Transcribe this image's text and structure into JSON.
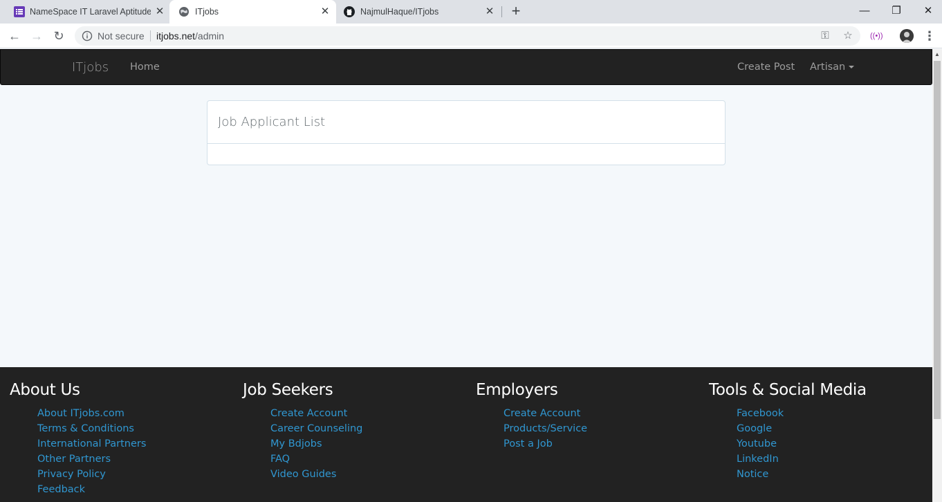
{
  "browser": {
    "tabs": [
      {
        "title": "NameSpace IT Laravel Aptitude T",
        "icon": "forms-icon",
        "active": false
      },
      {
        "title": "ITjobs",
        "icon": "globe-icon",
        "active": true
      },
      {
        "title": "NajmulHaque/ITjobs",
        "icon": "github-icon",
        "active": false
      }
    ],
    "address": {
      "security_label": "Not secure",
      "url_host": "itjobs.net",
      "url_path": "/admin"
    }
  },
  "site": {
    "brand": "ITjobs",
    "nav": {
      "home": "Home",
      "create_post": "Create Post",
      "user_menu": "Artisan"
    },
    "panel": {
      "title": "Job Applicant List"
    },
    "footer": {
      "columns": [
        {
          "heading": "About Us",
          "links": [
            "About ITjobs.com",
            "Terms & Conditions",
            "International Partners",
            "Other Partners",
            "Privacy Policy",
            "Feedback"
          ]
        },
        {
          "heading": "Job Seekers",
          "links": [
            "Create Account",
            "Career Counseling",
            "My Bdjobs",
            "FAQ",
            "Video Guides"
          ]
        },
        {
          "heading": "Employers",
          "links": [
            "Create Account",
            "Products/Service",
            "Post a Job"
          ]
        },
        {
          "heading": "Tools & Social Media",
          "links": [
            "Facebook",
            "Google",
            "Youtube",
            "LinkedIn",
            "Notice"
          ]
        }
      ]
    }
  },
  "colors": {
    "navbar_bg": "#222222",
    "footer_link": "#3097d1",
    "page_bg": "#f4f8fb"
  }
}
